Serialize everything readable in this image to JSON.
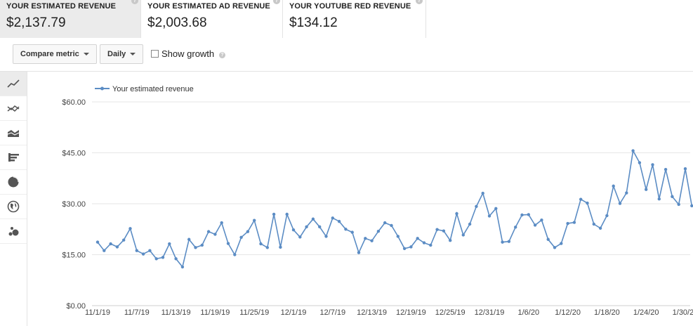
{
  "cards": [
    {
      "label": "YOUR ESTIMATED REVENUE",
      "value": "$2,137.79"
    },
    {
      "label": "YOUR ESTIMATED AD REVENUE",
      "value": "$2,003.68"
    },
    {
      "label": "YOUR YOUTUBE RED REVENUE",
      "value": "$134.12"
    }
  ],
  "toolbar": {
    "compare_label": "Compare metric",
    "interval_label": "Daily",
    "show_growth_label": "Show growth",
    "help_glyph": "?"
  },
  "rail_icons": [
    "line-chart-icon",
    "multi-line-chart-icon",
    "stacked-area-chart-icon",
    "bar-chart-icon",
    "pie-chart-icon",
    "globe-map-icon",
    "bubble-chart-icon"
  ],
  "colors": {
    "series": "#5b8cc4",
    "grid": "#e6e6e6",
    "active_card": "#ebebeb"
  },
  "chart_data": {
    "type": "line",
    "legend": "Your estimated revenue",
    "y_ticks": [
      "$60.00",
      "$45.00",
      "$30.00",
      "$15.00",
      "$0.00"
    ],
    "y_tick_values": [
      60,
      45,
      30,
      15,
      0
    ],
    "ylim": [
      0,
      60
    ],
    "x_ticks": [
      "11/1/19",
      "11/7/19",
      "11/13/19",
      "11/19/19",
      "11/25/19",
      "12/1/19",
      "12/7/19",
      "12/13/19",
      "12/19/19",
      "12/25/19",
      "12/31/19",
      "1/6/20",
      "1/12/20",
      "1/18/20",
      "1/24/20",
      "1/30/20"
    ],
    "x_tick_step_days": 6,
    "start": "11/1/19",
    "values": [
      18.7,
      16.2,
      18.2,
      17.3,
      19.3,
      22.7,
      16.2,
      15.2,
      16.2,
      13.8,
      14.2,
      18.2,
      13.8,
      11.4,
      19.5,
      17.1,
      17.8,
      21.8,
      21.0,
      24.4,
      18.3,
      15.0,
      20.1,
      21.8,
      25.1,
      18.2,
      17.1,
      26.9,
      17.2,
      26.9,
      22.3,
      20.2,
      23.2,
      25.5,
      23.2,
      20.4,
      25.8,
      24.8,
      22.5,
      21.6,
      15.6,
      19.8,
      19.1,
      21.9,
      24.4,
      23.6,
      20.4,
      16.8,
      17.3,
      19.8,
      18.5,
      17.8,
      22.4,
      22.0,
      19.2,
      27.1,
      20.8,
      24.0,
      29.2,
      33.1,
      26.4,
      28.6,
      18.7,
      18.9,
      23.1,
      26.7,
      26.8,
      23.7,
      25.2,
      19.5,
      17.1,
      18.3,
      24.2,
      24.5,
      31.3,
      30.2,
      24.0,
      22.8,
      26.5,
      35.2,
      30.1,
      33.2,
      45.6,
      42.1,
      34.2,
      41.5,
      31.4,
      40.1,
      32.1,
      29.8,
      40.3,
      29.4
    ]
  }
}
